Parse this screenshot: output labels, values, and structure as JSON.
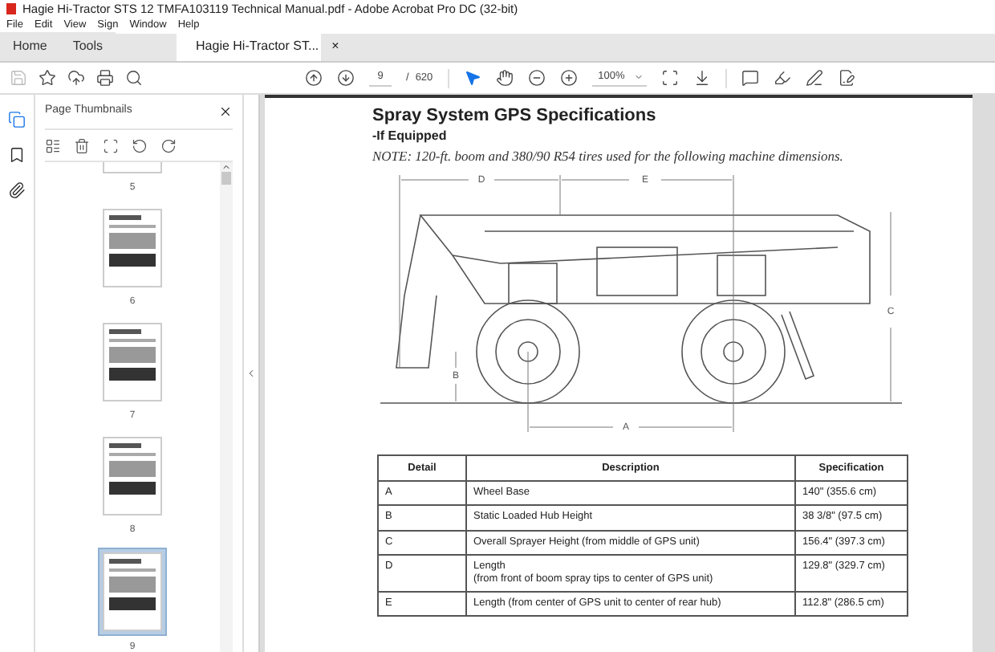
{
  "window": {
    "title": "Hagie Hi-Tractor STS 12 TMFA103119 Technical Manual.pdf - Adobe Acrobat Pro DC (32-bit)"
  },
  "menu": [
    "File",
    "Edit",
    "View",
    "Sign",
    "Window",
    "Help"
  ],
  "tabs": [
    {
      "label": "Home",
      "selected": false,
      "kind": "nav"
    },
    {
      "label": "Tools",
      "selected": false,
      "kind": "nav"
    },
    {
      "label": "Hagie Hi-Tractor ST...",
      "selected": true,
      "kind": "doc",
      "close": "×"
    }
  ],
  "toolbar": {
    "page": "9",
    "page_sep": "/",
    "page_count": "620",
    "zoom": "100%",
    "tools": [
      {
        "kind": "select",
        "selected": true
      },
      {
        "kind": "hand",
        "selected": false
      }
    ]
  },
  "thumbnails_panel": {
    "title": "Page Thumbnails",
    "pages": [
      {
        "label": "5",
        "selected": false
      },
      {
        "label": "6",
        "selected": false
      },
      {
        "label": "7",
        "selected": false
      },
      {
        "label": "8",
        "selected": false
      },
      {
        "label": "9",
        "selected": true
      }
    ]
  },
  "document": {
    "heading": "Spray System GPS Specifications",
    "subheading": "-If Equipped",
    "note": "NOTE: 120-ft. boom and 380/90 R54 tires used for the following machine dimensions.",
    "dimension_labels": [
      "D",
      "E",
      "C",
      "B",
      "A"
    ],
    "table": {
      "columns": [
        "Detail",
        "Description",
        "Specification"
      ],
      "rows": [
        [
          "A",
          "Wheel Base",
          "140\" (355.6 cm)"
        ],
        [
          "B",
          "Static Loaded Hub Height",
          "38 3/8\" (97.5 cm)"
        ],
        [
          "C",
          "Overall Sprayer Height (from middle of GPS unit)",
          "156.4\" (397.3 cm)"
        ],
        [
          "D",
          "Length\n(from front of boom spray tips to center of GPS unit)",
          "129.8\" (329.7 cm)"
        ],
        [
          "E",
          "Length (from center of GPS unit to center of rear hub)",
          "112.8\" (286.5 cm)"
        ]
      ]
    }
  }
}
